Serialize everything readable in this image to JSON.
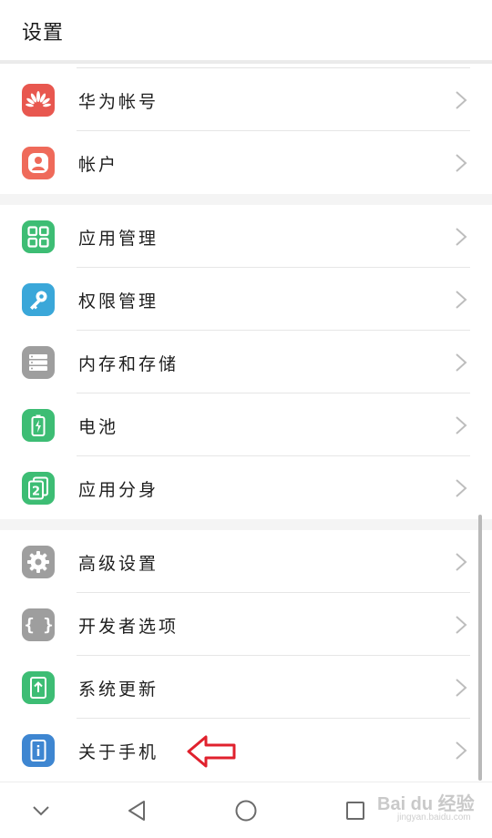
{
  "header": {
    "title": "设置"
  },
  "colors": {
    "huawei": "#e8574f",
    "account": "#ef6a5a",
    "app_manage": "#3dbd74",
    "permission": "#3aa7d9",
    "storage": "#9e9e9e",
    "battery": "#3dbd74",
    "twin": "#3dbd74",
    "advanced": "#9e9e9e",
    "developer": "#9e9e9e",
    "update": "#3dbd74",
    "about": "#3e86d1",
    "annotation_arrow": "#e0212d"
  },
  "sections": [
    {
      "items": [
        {
          "label": "华为帐号",
          "icon": "huawei-logo-icon"
        },
        {
          "label": "帐户",
          "icon": "person-icon"
        }
      ]
    },
    {
      "items": [
        {
          "label": "应用管理",
          "icon": "grid-icon"
        },
        {
          "label": "权限管理",
          "icon": "key-icon"
        },
        {
          "label": "内存和存储",
          "icon": "storage-icon"
        },
        {
          "label": "电池",
          "icon": "battery-icon"
        },
        {
          "label": "应用分身",
          "icon": "twin-app-icon"
        }
      ]
    },
    {
      "items": [
        {
          "label": "高级设置",
          "icon": "gear-icon"
        },
        {
          "label": "开发者选项",
          "icon": "braces-icon"
        },
        {
          "label": "系统更新",
          "icon": "update-icon"
        },
        {
          "label": "关于手机",
          "icon": "info-icon"
        }
      ]
    }
  ],
  "twin_icon_number": "2",
  "developer_icon_text": "{ }",
  "watermark": {
    "brand": "Bai du 经验",
    "url": "jingyan.baidu.com"
  }
}
